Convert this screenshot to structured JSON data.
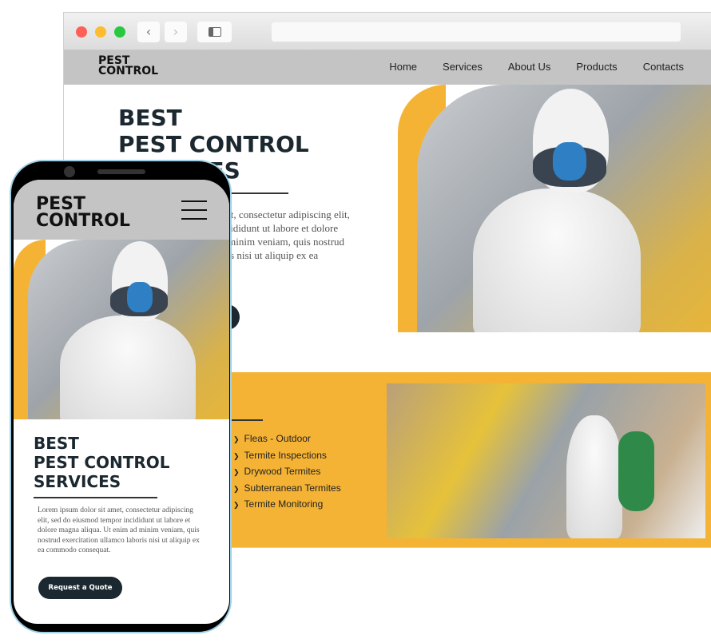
{
  "browser": {
    "back_icon": "chevron-left-icon",
    "forward_icon": "chevron-right-icon",
    "sidebar_icon": "sidebar-icon",
    "url": ""
  },
  "site": {
    "logo": [
      "PEST",
      "CONTROL"
    ],
    "nav": [
      "Home",
      "Services",
      "About Us",
      "Products",
      "Contacts"
    ],
    "hero": {
      "title": [
        "BEST",
        "PEST CONTROL",
        "SERVICES"
      ],
      "paragraph": "Lorem ipsum dolor sit amet, consectetur adipiscing elit, sed do eiusmod tempor incididunt ut labore et dolore magna aliqua. Ut enim ad minim veniam, quis nostrud exercitation ullamco laboris nisi ut aliquip ex ea commodo consequat.",
      "button": "Request a Quote"
    },
    "services": [
      "Fleas - Outdoor",
      "Termite Inspections",
      "Drywood Termites",
      "Subterranean Termites",
      "Termite Monitoring"
    ]
  },
  "mobile": {
    "menu_icon": "hamburger-menu-icon"
  },
  "colors": {
    "accent": "#f5b335",
    "dark": "#1b2830",
    "nav": "#c4c4c4"
  }
}
